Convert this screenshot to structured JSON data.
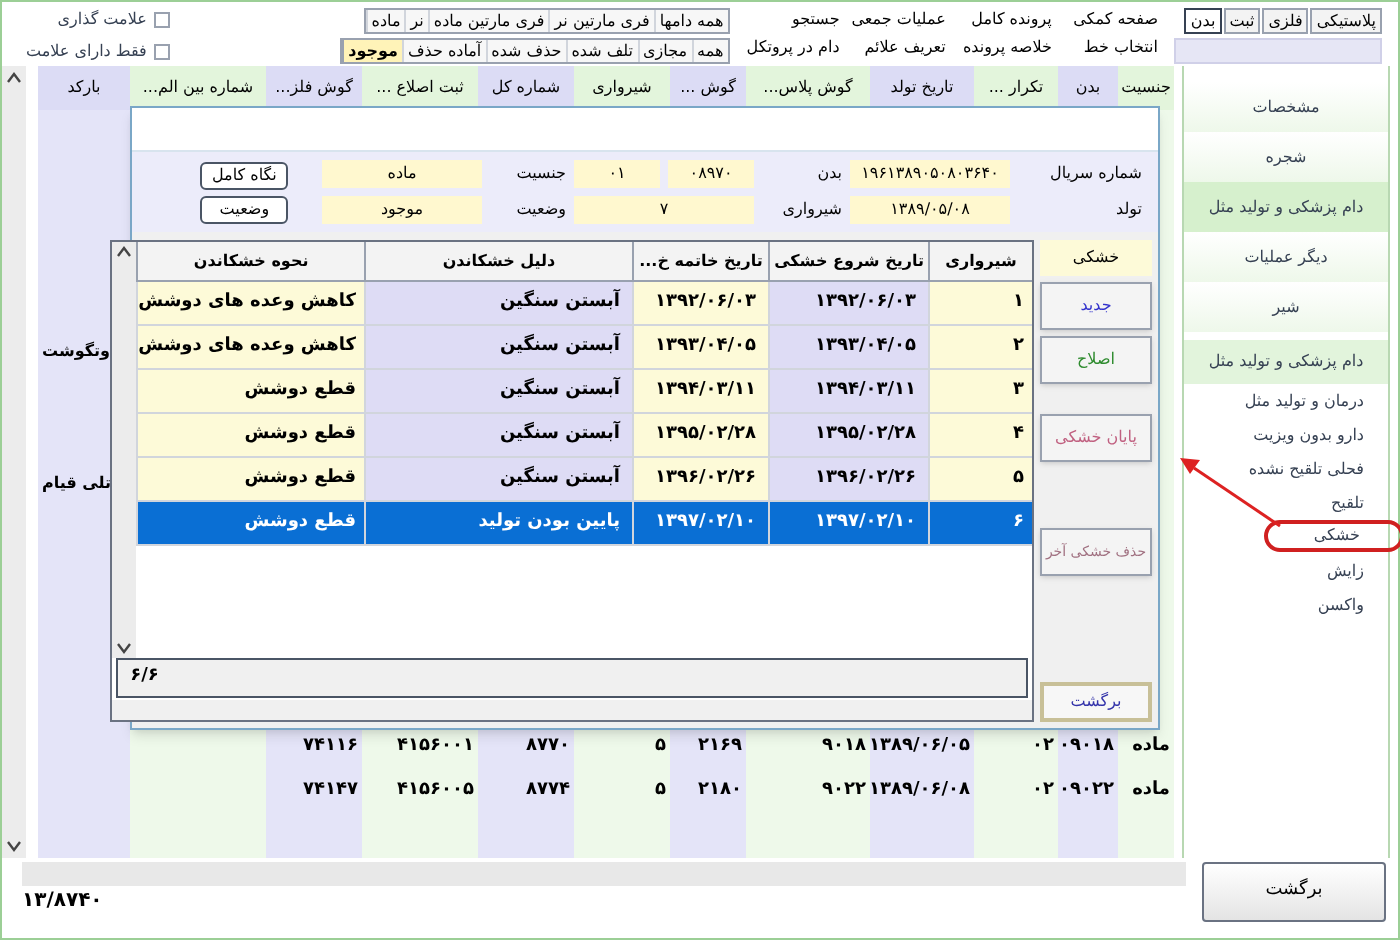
{
  "top_tabs": [
    {
      "label": "پلاستیکی",
      "selected": false
    },
    {
      "label": "فلزی",
      "selected": false
    },
    {
      "label": "ثبت",
      "selected": false
    },
    {
      "label": "بدن",
      "selected": true
    }
  ],
  "menu": [
    "صفحه کمکی",
    "پرونده کامل",
    "عملیات جمعی",
    "جستجو",
    "انتخاب خط",
    "خلاصه پرونده",
    "تعریف علائم",
    "دام در پروتکل"
  ],
  "sex_filters": [
    {
      "label": "همه دامها",
      "selected": false
    },
    {
      "label": "فری مارتین نر",
      "selected": false
    },
    {
      "label": "فری مارتین ماده",
      "selected": false
    },
    {
      "label": "نر",
      "selected": false
    },
    {
      "label": "ماده",
      "selected": false
    }
  ],
  "status_filters": [
    {
      "label": "همه",
      "selected": false
    },
    {
      "label": "مجازی",
      "selected": false
    },
    {
      "label": "تلف شده",
      "selected": false
    },
    {
      "label": "حذف شده",
      "selected": false
    },
    {
      "label": "آماده حذف",
      "selected": false
    },
    {
      "label": "موجود",
      "selected": true
    }
  ],
  "checkboxes": [
    {
      "label": "علامت گذاری",
      "checked": false
    },
    {
      "label": "فقط دارای علامت",
      "checked": false
    }
  ],
  "main_table": {
    "columns": [
      "جنسیت",
      "بدن",
      "تکرار ...",
      "تاریخ تولد",
      "گوش پلاس...",
      "گوش ...",
      "شیرواری",
      "شماره کل",
      "ثبت اصلاع ...",
      "گوش فلز...",
      "شماره بین الم...",
      "بارکد"
    ],
    "side_texts": [
      "وتگوشت",
      "تلی قیام"
    ],
    "rows": [
      [
        "ماده",
        "۰۹۰۱۸",
        "۰۲",
        "۱۳۸۹/۰۶/۰۵",
        "۹۰۱۸",
        "۲۱۶۹",
        "۵",
        "۸۷۷۰",
        "۴۱۵۶۰۰۱",
        "۷۴۱۱۶"
      ],
      [
        "ماده",
        "۰۹۰۲۲",
        "۰۲",
        "۱۳۸۹/۰۶/۰۸",
        "۹۰۲۲",
        "۲۱۸۰",
        "۵",
        "۸۷۷۴",
        "۴۱۵۶۰۰۵",
        "۷۴۱۴۷"
      ]
    ]
  },
  "footer": {
    "count": "۱۳/۸۷۴۰",
    "back_button": "برگشت"
  },
  "sidebar": {
    "items": [
      {
        "label": "مشخصات",
        "selected": false
      },
      {
        "label": "شجره",
        "selected": false
      },
      {
        "label": "دام پزشکی و تولید مثل",
        "selected": true
      },
      {
        "label": "دیگر عملیات",
        "selected": false
      },
      {
        "label": "شیر",
        "selected": false
      }
    ],
    "section_title": "دام پزشکی و تولید مثل",
    "sub_items": [
      {
        "label": "درمان و تولید مثل",
        "circled": false
      },
      {
        "label": "دارو بدون ویزیت",
        "circled": false
      },
      {
        "label": "فحلی تلقیح نشده",
        "circled": false
      },
      {
        "label": "تلقیح",
        "circled": false
      },
      {
        "label": "خشکی",
        "circled": true
      },
      {
        "label": "زایش",
        "circled": false
      },
      {
        "label": "واکسن",
        "circled": false
      }
    ]
  },
  "dialog": {
    "info_rows": [
      [
        {
          "label": "شماره سریال",
          "values": [
            "۱۹۶۱۳۸۹۰۵۰۸۰۳۶۴۰"
          ]
        },
        {
          "label": "بدن",
          "values": [
            "۰۸۹۷۰",
            "۰۱"
          ]
        },
        {
          "label": "جنسیت",
          "values": [
            "ماده"
          ]
        }
      ],
      [
        {
          "label": "تولد",
          "values": [
            "۱۳۸۹/۰۵/۰۸"
          ]
        },
        {
          "label": "شیرواری",
          "values": [
            "۷"
          ]
        },
        {
          "label": "وضعیت",
          "values": [
            "موجود"
          ]
        }
      ]
    ],
    "info_buttons": [
      "نگاه کامل",
      "وضعیت"
    ],
    "table": {
      "columns": [
        "شیرواری",
        "تاریخ شروع خشکی",
        "تاریخ خاتمه خ...",
        "دلیل خشکاندن",
        "نحوه خشکاندن"
      ],
      "rows": [
        {
          "cells": [
            "۱",
            "۱۳۹۲/۰۶/۰۳",
            "۱۳۹۲/۰۶/۰۳",
            "آبستن سنگین",
            "کاهش وعده های دوشش"
          ],
          "selected": false
        },
        {
          "cells": [
            "۲",
            "۱۳۹۳/۰۴/۰۵",
            "۱۳۹۳/۰۴/۰۵",
            "آبستن سنگین",
            "کاهش وعده های دوشش"
          ],
          "selected": false
        },
        {
          "cells": [
            "۳",
            "۱۳۹۴/۰۳/۱۱",
            "۱۳۹۴/۰۳/۱۱",
            "آبستن سنگین",
            "قطع دوشش"
          ],
          "selected": false
        },
        {
          "cells": [
            "۴",
            "۱۳۹۵/۰۲/۲۸",
            "۱۳۹۵/۰۲/۲۸",
            "آبستن سنگین",
            "قطع دوشش"
          ],
          "selected": false
        },
        {
          "cells": [
            "۵",
            "۱۳۹۶/۰۲/۲۶",
            "۱۳۹۶/۰۲/۲۶",
            "آبستن سنگین",
            "قطع دوشش"
          ],
          "selected": false
        },
        {
          "cells": [
            "۶",
            "۱۳۹۷/۰۲/۱۰",
            "۱۳۹۷/۰۲/۱۰",
            "پایین بودن تولید",
            "قطع دوشش"
          ],
          "selected": true
        }
      ]
    },
    "record_count": "۶/۶",
    "section_label": "خشکی",
    "actions": [
      {
        "label": "جدید",
        "color": "#3333cc"
      },
      {
        "label": "اصلاح",
        "color": "#2e8b2e"
      },
      {
        "label": "پایان خشکی",
        "color": "#c06080"
      },
      {
        "label": "حذف خشکی آخر",
        "color": "#a07080"
      }
    ],
    "back_button": "برگشت"
  }
}
